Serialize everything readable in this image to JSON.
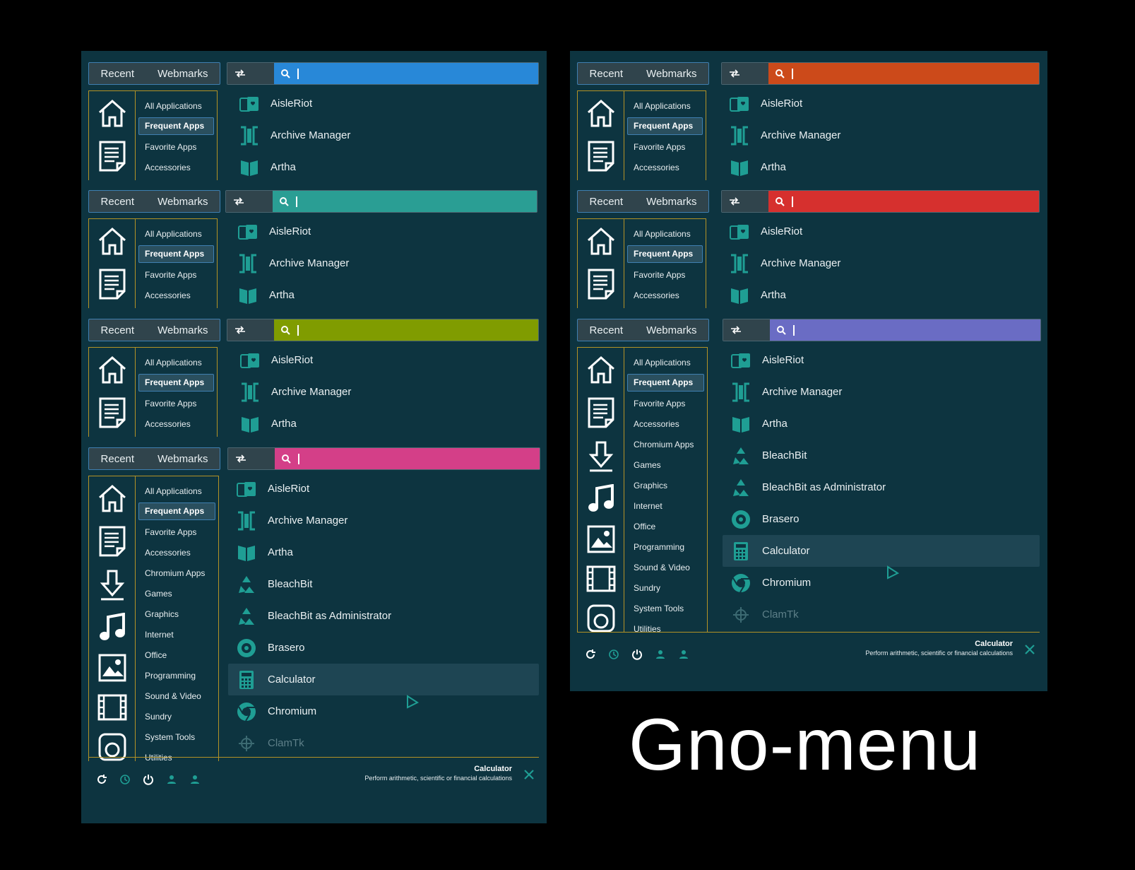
{
  "tabs": {
    "recent": "Recent",
    "webmarks": "Webmarks"
  },
  "search": {
    "placeholder": ""
  },
  "search_colors": [
    "#2888d8",
    "#2a9e94",
    "#809c00",
    "#d43f88",
    "#cc4a1a",
    "#d6302e",
    "#6a6cc4"
  ],
  "categories": [
    "All Applications",
    "Frequent Apps",
    "Favorite Apps",
    "Accessories",
    "Chromium Apps",
    "Games",
    "Graphics",
    "Internet",
    "Office",
    "Programming",
    "Sound & Video",
    "Sundry",
    "System Tools",
    "Utilities"
  ],
  "active_category": "Frequent Apps",
  "category_icons": [
    "home-icon",
    "document-icon",
    "download-icon",
    "music-icon",
    "image-icon",
    "film-icon",
    "disk-icon"
  ],
  "apps": [
    "AisleRiot",
    "Archive Manager",
    "Artha",
    "BleachBit",
    "BleachBit as Administrator",
    "Brasero",
    "Calculator",
    "Chromium",
    "ClamTk"
  ],
  "selected_app": "Calculator",
  "footer": {
    "title": "Calculator",
    "description": "Perform arithmetic, scientific or financial calculations"
  },
  "footer_icons": [
    "refresh-icon",
    "clock-icon",
    "power-icon",
    "user-icon",
    "user-switch-icon"
  ],
  "caption": "Gno-menu",
  "colors": {
    "panel": "#0d3440",
    "accent_border": "#b39226",
    "tab_border": "#3f7fb0",
    "icon": "#1f9e94"
  }
}
